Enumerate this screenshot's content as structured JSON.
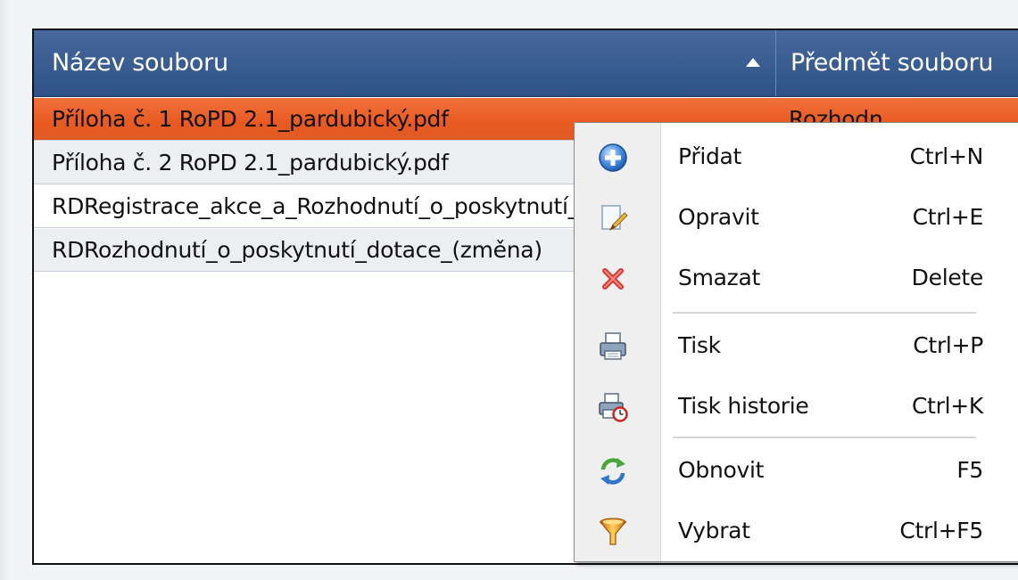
{
  "grid": {
    "columns": [
      {
        "label": "Název souboru",
        "sorted": "ascending"
      },
      {
        "label": "Předmět souboru"
      }
    ],
    "rows": [
      {
        "name": "Příloha č. 1 RoPD 2.1_pardubický.pdf",
        "subject": "Rozhodn",
        "selected": true
      },
      {
        "name": "Příloha č. 2 RoPD 2.1_pardubický.pdf",
        "subject": ""
      },
      {
        "name": "RDRegistrace_akce_a_Rozhodnutí_o_poskytnutí_dotace",
        "subject": ""
      },
      {
        "name": "RDRozhodnutí_o_poskytnutí_dotace_(změna)",
        "subject": ""
      }
    ]
  },
  "context_menu": {
    "items": [
      {
        "label": "Přidat",
        "shortcut": "Ctrl+N",
        "icon": "add-icon"
      },
      {
        "label": "Opravit",
        "shortcut": "Ctrl+E",
        "icon": "edit-icon"
      },
      {
        "label": "Smazat",
        "shortcut": "Delete",
        "icon": "delete-icon"
      },
      {
        "label": "Tisk",
        "shortcut": "Ctrl+P",
        "icon": "print-icon"
      },
      {
        "label": "Tisk historie",
        "shortcut": "Ctrl+K",
        "icon": "print-history-icon"
      },
      {
        "label": "Obnovit",
        "shortcut": "F5",
        "icon": "refresh-icon"
      },
      {
        "label": "Vybrat",
        "shortcut": "Ctrl+F5",
        "icon": "filter-icon"
      }
    ]
  },
  "colors": {
    "header": "#3a5d92",
    "selected_row": "#e85a22",
    "menu_gutter": "#efefef"
  }
}
